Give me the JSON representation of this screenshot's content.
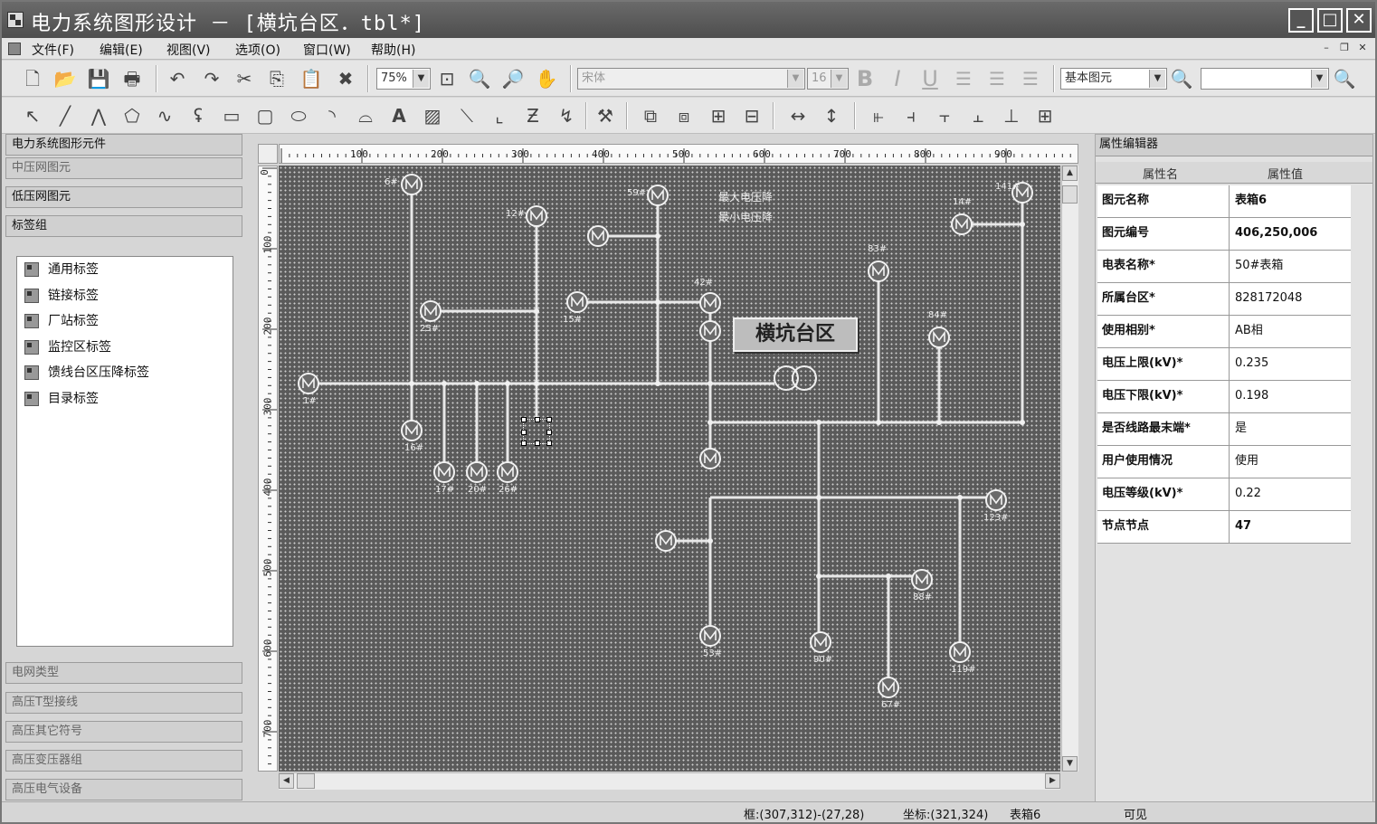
{
  "window": {
    "title": "电力系统图形设计 － [横坑台区．tbl*]",
    "min": "_",
    "max": "□",
    "close": "✕"
  },
  "menu": [
    "文件(F)",
    "编辑(E)",
    "视图(V)",
    "选项(O)",
    "窗口(W)",
    "帮助(H)"
  ],
  "toolbar": {
    "zoom": "75%",
    "font": "宋体",
    "font_size": "16",
    "element_type": "基本图元",
    "search": ""
  },
  "left_panel": {
    "title": "电力系统图形元件",
    "groups_top": [
      "中压网图元",
      "低压网图元",
      "标签组"
    ],
    "tag_items": [
      "通用标签",
      "链接标签",
      "厂站标签",
      "监控区标签",
      "馈线台区压降标签",
      "目录标签"
    ],
    "groups_bottom": [
      "电网类型",
      "高压T型接线",
      "高压其它符号",
      "高压变压器组",
      "高压电气设备"
    ]
  },
  "rulers": {
    "h": [
      "100",
      "200",
      "300",
      "400",
      "500",
      "600",
      "700",
      "800",
      "900"
    ],
    "v": [
      "0",
      "100",
      "200",
      "300",
      "400",
      "500",
      "600",
      "700"
    ]
  },
  "diagram": {
    "title": "横坑台区",
    "legend_max": "最大电压降",
    "legend_min": "最小电压降",
    "meters": [
      {
        "label": "6#"
      },
      {
        "label": "12#"
      },
      {
        "label": "59#"
      },
      {
        "label": "25#"
      },
      {
        "label": "15#"
      },
      {
        "label": "42#"
      },
      {
        "label": "1#"
      },
      {
        "label": "16#"
      },
      {
        "label": "17#"
      },
      {
        "label": "20#"
      },
      {
        "label": "26#"
      },
      {
        "label": "83#"
      },
      {
        "label": "84#"
      },
      {
        "label": "14#"
      },
      {
        "label": "141#"
      },
      {
        "label": "123#"
      },
      {
        "label": "53#"
      },
      {
        "label": "90#"
      },
      {
        "label": "88#"
      },
      {
        "label": "67#"
      },
      {
        "label": "119#"
      },
      {
        "label": ""
      },
      {
        "label": ""
      },
      {
        "label": ""
      },
      {
        "label": ""
      }
    ]
  },
  "properties": {
    "title": "属性编辑器",
    "col_name": "属性名",
    "col_value": "属性值",
    "rows": [
      {
        "k": "图元名称",
        "v": "表箱6"
      },
      {
        "k": "图元编号",
        "v": "406,250,006"
      },
      {
        "k": "电表名称*",
        "v": "50#表箱"
      },
      {
        "k": "所属台区*",
        "v": "828172048"
      },
      {
        "k": "使用相别*",
        "v": "AB相"
      },
      {
        "k": "电压上限(kV)*",
        "v": "0.235"
      },
      {
        "k": "电压下限(kV)*",
        "v": "0.198"
      },
      {
        "k": "是否线路最末端*",
        "v": "是"
      },
      {
        "k": "用户使用情况",
        "v": "使用"
      },
      {
        "k": "电压等级(kV)*",
        "v": "0.22"
      },
      {
        "k": "节点节点",
        "v": "47"
      }
    ]
  },
  "status": {
    "frame": "框:(307,312)-(27,28)",
    "coord": "坐标:(321,324)",
    "name": "表箱6",
    "visible": "可见"
  }
}
